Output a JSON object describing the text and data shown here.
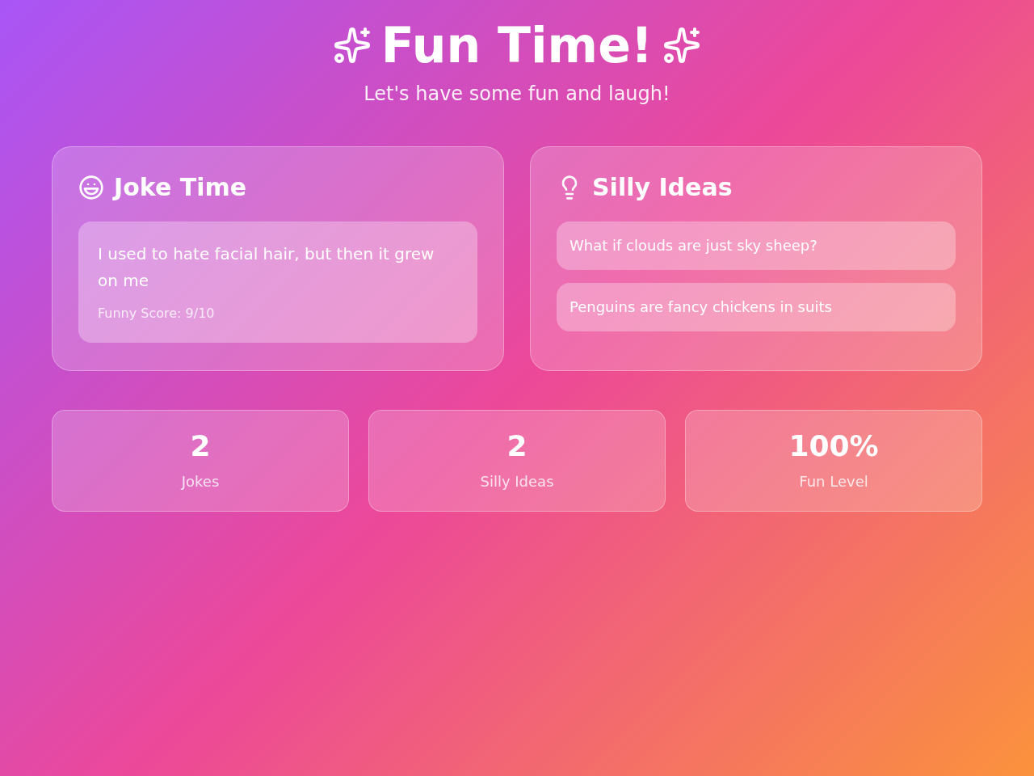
{
  "header": {
    "title": "Fun Time!",
    "subtitle": "Let's have some fun and laugh!"
  },
  "cards": [
    {
      "kind": "jokes",
      "title": "Joke Time",
      "items": [
        {
          "text": "I used to hate facial hair, but then it grew on me",
          "score": "Funny Score: 9/10"
        }
      ]
    },
    {
      "kind": "ideas",
      "title": "Silly Ideas",
      "items": [
        {
          "text": "What if clouds are just sky sheep?"
        },
        {
          "text": "Penguins are fancy chickens in suits"
        }
      ]
    }
  ],
  "stats": [
    {
      "value": "2",
      "label": "Jokes"
    },
    {
      "value": "2",
      "label": "Silly Ideas"
    },
    {
      "value": "100%",
      "label": "Fun Level"
    }
  ]
}
